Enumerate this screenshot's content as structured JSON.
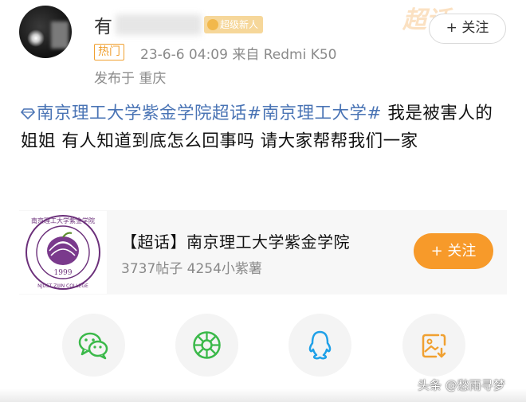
{
  "header": {
    "username_visible": "有",
    "level_badge": "超级新人",
    "watermark": "超话",
    "follow_label": "+ 关注",
    "hot_tag": "热门",
    "meta": "23-6-6 04:09  来自 Redmi K50",
    "location": "发布于 重庆"
  },
  "post": {
    "topic_1": "南京理工大学紫金学院超话",
    "topic_2": "#南京理工大学#",
    "text": " 我是被害人的姐姐 有人知道到底怎么回事吗 请大家帮帮我们一家"
  },
  "card": {
    "title": "【超话】南京理工大学紫金学院",
    "stats": "3737帖子 4254小紫薯",
    "follow_label": "+ 关注",
    "logo_year": "1999",
    "logo_text": "NJUST ZIJIN COLLEGE",
    "logo_cn": "南京理工大学紫金学院"
  },
  "share": {
    "items": [
      {
        "icon": "wechat-icon"
      },
      {
        "icon": "moments-icon"
      },
      {
        "icon": "qq-icon"
      },
      {
        "icon": "save-image-icon"
      }
    ]
  },
  "credit": "头条 @愁雨寻梦",
  "colors": {
    "link": "#4a74b5",
    "accent_orange": "#f79a2a",
    "green": "#3bb94a",
    "qq_blue": "#1ea0e8"
  }
}
